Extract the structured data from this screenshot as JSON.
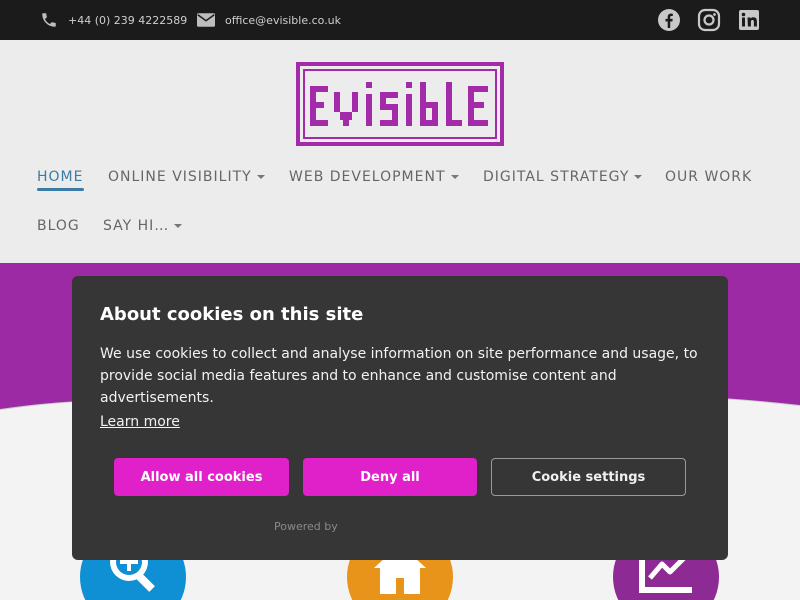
{
  "topbar": {
    "phone": "+44 (0) 239 4222589",
    "email": "office@evisible.co.uk",
    "social": [
      "facebook-icon",
      "instagram-icon",
      "linkedin-icon"
    ]
  },
  "logo": {
    "text": "EVISIBLE",
    "color": "#a32aa8"
  },
  "nav": {
    "items": [
      {
        "label": "HOME",
        "active": true
      },
      {
        "label": "ONLINE VISIBILITY",
        "dropdown": true
      },
      {
        "label": "WEB DEVELOPMENT",
        "dropdown": true
      },
      {
        "label": "DIGITAL STRATEGY",
        "dropdown": true
      },
      {
        "label": "OUR WORK"
      },
      {
        "label": "BLOG"
      },
      {
        "label": "SAY HI…",
        "dropdown": true
      }
    ]
  },
  "cookie": {
    "title": "About cookies on this site",
    "body": "We use cookies to collect and analyse information on site performance and usage, to provide social media features and to enhance and customise content and advertisements.",
    "learn_more": "Learn more",
    "allow": "Allow all cookies",
    "deny": "Deny all",
    "settings": "Cookie settings",
    "powered": "Powered by"
  },
  "features": [
    "magnifier-plus-icon",
    "house-icon",
    "line-chart-icon"
  ],
  "colors": {
    "accent": "#e021c9",
    "brand_purple": "#9c2aa4",
    "nav_active": "#3a7ca5"
  }
}
